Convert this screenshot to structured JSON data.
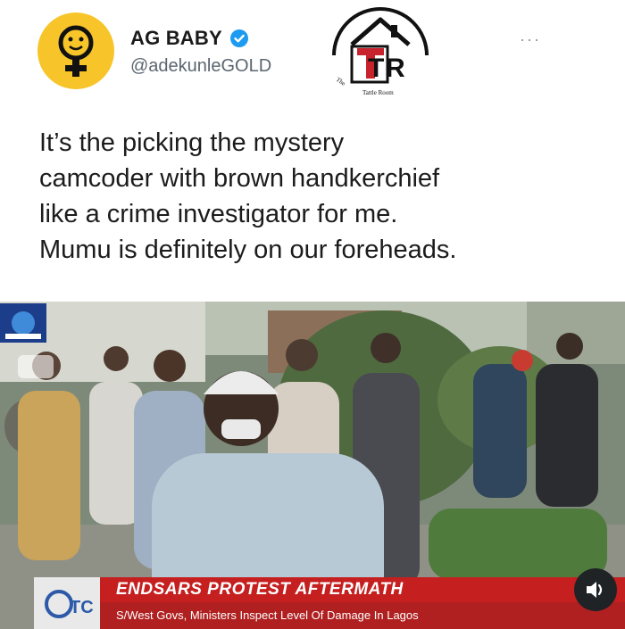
{
  "post": {
    "display_name": "AG BABY",
    "handle": "@adekunleGOLD",
    "verified": true,
    "more_label": "···",
    "text_lines": [
      "It’s the picking the mystery",
      "camcoder with brown handkerchief",
      "like a crime investigator for me.",
      "Mumu is definitely on our foreheads."
    ]
  },
  "watermark": {
    "letters": "TTR",
    "caption": "The Tattle Room"
  },
  "video": {
    "headline": "ENDSARS PROTEST AFTERMATH",
    "subheadline": "S/West Govs, Ministers Inspect Level Of Damage In Lagos",
    "corner_label": "TC"
  },
  "colors": {
    "avatar_bg": "#f7c52a",
    "verified": "#1d9bf0",
    "headline_bar": "#c51f1f",
    "logo_red": "#c8232c"
  },
  "icons": [
    "verified-badge-icon",
    "avatar-icon",
    "volume-icon",
    "more-icon",
    "channel-logo-icon"
  ]
}
